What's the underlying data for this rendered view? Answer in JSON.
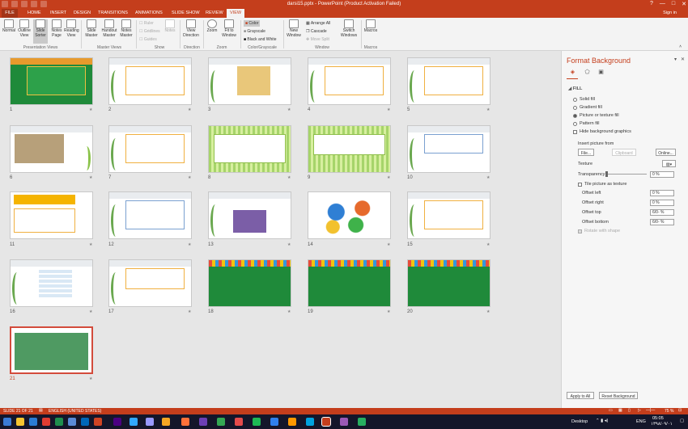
{
  "window": {
    "title": "darsi15.pptx - PowerPoint (Product Activation Failed)",
    "controls": [
      "?",
      "—",
      "□",
      "✕"
    ]
  },
  "tabs": {
    "file": "FILE",
    "items": [
      "HOME",
      "INSERT",
      "DESIGN",
      "TRANSITIONS",
      "ANIMATIONS",
      "SLIDE SHOW",
      "REVIEW",
      "VIEW"
    ],
    "active": "VIEW",
    "signin": "Sign in"
  },
  "ribbon": {
    "buttons": {
      "normal": "Normal",
      "outline": "Outline View",
      "sorter": "Slide Sorter",
      "notes": "Notes Page",
      "reading": "Reading View",
      "slide_master": "Slide Master",
      "handout_master": "Handout Master",
      "notes_master": "Notes Master",
      "ruler": "Ruler",
      "gridlines": "Gridlines",
      "guides": "Guides",
      "notes_disabled": "Notes",
      "view_direction": "View Direction",
      "zoom": "Zoom",
      "fit_window": "Fit to Window",
      "color": "Color",
      "grayscale": "Grayscale",
      "bw": "Black and White",
      "new_window": "New Window",
      "arrange_all": "Arrange All",
      "cascade": "Cascade",
      "move_split": "Move Split",
      "switch_windows": "Switch Windows",
      "macros": "Macros"
    },
    "groups": {
      "presentation_views": "Presentation Views",
      "master_views": "Master Views",
      "show": "Show",
      "direction": "Direction",
      "zoom": "Zoom",
      "color": "Color/Grayscale",
      "window": "Window",
      "macros": "Macros"
    }
  },
  "slides": {
    "numbers": [
      "1",
      "2",
      "3",
      "4",
      "5",
      "6",
      "7",
      "8",
      "9",
      "10",
      "11",
      "12",
      "13",
      "14",
      "15",
      "16",
      "17",
      "18",
      "19",
      "20",
      "21"
    ],
    "selected": "21",
    "star": "★"
  },
  "format_panel": {
    "title": "Format Background",
    "fill_header": "◢ FILL",
    "options": {
      "solid": "Solid fill",
      "gradient": "Gradient fill",
      "picture": "Picture or texture fill",
      "pattern": "Pattern fill",
      "hide_graphics": "Hide background graphics"
    },
    "selected_fill": "Picture or texture fill",
    "insert_from": "Insert picture from",
    "file_btn": "File...",
    "clipboard_btn": "Clipboard",
    "online_btn": "Online...",
    "texture_label": "Texture",
    "transparency_label": "Transparency",
    "transparency_value": "0 %",
    "tile_label": "Tile picture as texture",
    "offset_left": "Offset left",
    "offset_left_val": "0 %",
    "offset_right": "Offset right",
    "offset_right_val": "0 %",
    "offset_top": "Offset top",
    "offset_top_val": "6/0- %",
    "offset_bottom": "Offset bottom",
    "offset_bottom_val": "6/0- %",
    "rotate_label": "Rotate with shape",
    "apply_all": "Apply to All",
    "reset": "Reset Background"
  },
  "status": {
    "slide": "SLIDE 21 OF 21",
    "language": "ENGLISH (UNITED STATES)",
    "zoom": "75 %"
  },
  "taskbar": {
    "desktop": "Desktop",
    "lang": "ENG",
    "time": "05:05",
    "date": "۱۳۹۸/۰۹/۰۱"
  },
  "colors": {
    "accent": "#c43e1c",
    "panel_bg": "#f6f6f6",
    "workspace": "#e6e6e6"
  }
}
